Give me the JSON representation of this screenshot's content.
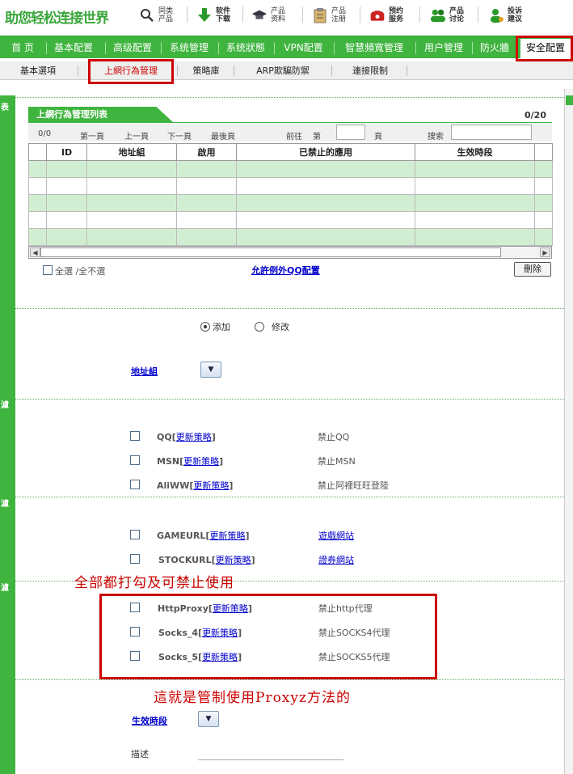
{
  "header": {
    "logo": "助您轻松连接世界",
    "links": [
      {
        "label": "同类产品",
        "icon": "search-icon"
      },
      {
        "label": "软件下载",
        "icon": "download-icon"
      },
      {
        "label": "产品资料",
        "icon": "graduation-cap-icon"
      },
      {
        "label": "产品注册",
        "icon": "clipboard-icon"
      },
      {
        "label": "预约服务",
        "icon": "phone-icon"
      },
      {
        "label": "产品讨论",
        "icon": "users-icon"
      },
      {
        "label": "投诉建议",
        "icon": "user-complaint-icon"
      }
    ]
  },
  "main_nav": [
    "首 页",
    "基本配置",
    "高级配置",
    "系统管理",
    "系统狀態",
    "VPN配置",
    "智慧頻寬管理",
    "用户管理",
    "防火牆",
    "安全配置"
  ],
  "sub_nav": [
    "基本選項",
    "上網行為管理",
    "策略庫",
    "ARP欺騙防禦",
    "連接限制"
  ],
  "side_labels": [
    "表",
    "濾",
    "濾",
    "濾"
  ],
  "panel": {
    "title": "上網行為管理列表",
    "count": "0/20",
    "pager": {
      "count": "0/0",
      "first": "第一頁",
      "prev": "上一頁",
      "next": "下一頁",
      "last": "最後頁",
      "goto": "前往",
      "page_prefix": "第",
      "page_suffix": "頁",
      "search": "搜索"
    },
    "columns": [
      "",
      "ID",
      "地址組",
      "啟用",
      "已禁止的應用",
      "生效時段",
      ""
    ],
    "select_all": "全選 /全不選",
    "qq_config": "允許例外QQ配置",
    "delete": "刪除"
  },
  "form": {
    "mode_add": "添加",
    "mode_modify": "修改",
    "address_group": "地址組",
    "update_label": "更新策略",
    "policies": [
      {
        "name": "QQ",
        "desc": "禁止QQ",
        "desc_link": false
      },
      {
        "name": "MSN",
        "desc": "禁止MSN",
        "desc_link": false
      },
      {
        "name": "AliWW",
        "desc": "禁止阿裡旺旺登陸",
        "desc_link": false
      },
      {
        "name": "GAMEURL",
        "desc": "遊戲網站",
        "desc_link": true
      },
      {
        "name": "STOCKURL",
        "desc": "證券網站",
        "desc_link": true
      },
      {
        "name": "HttpProxy",
        "desc": "禁止http代理",
        "desc_link": false
      },
      {
        "name": "Socks_4",
        "desc": "禁止SOCKS4代理",
        "desc_link": false
      },
      {
        "name": "Socks_5",
        "desc": "禁止SOCKS5代理",
        "desc_link": false
      }
    ],
    "schedule": "生效時段",
    "description": "描述"
  },
  "annotations": {
    "note_top": "全部都打勾及可禁止使用",
    "note_bottom": "這就是管制使用Proxyz方法的"
  },
  "colors": {
    "green": "#3fb43f",
    "row_green": "#d2eed2",
    "highlight_red": "#cc0000",
    "link_blue": "#0000cc"
  }
}
